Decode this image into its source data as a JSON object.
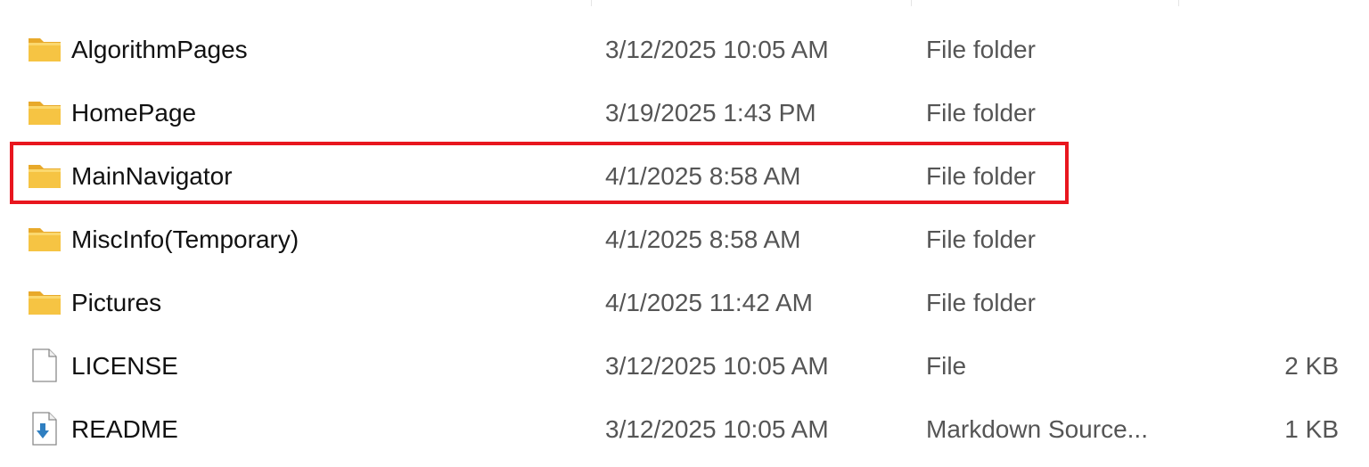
{
  "colors": {
    "highlight": "#e8161e",
    "folder": "#f6c443",
    "secondary_text": "#555555"
  },
  "files": [
    {
      "name": "AlgorithmPages",
      "date": "3/12/2025 10:05 AM",
      "type": "File folder",
      "size": "",
      "icon": "folder-icon"
    },
    {
      "name": "HomePage",
      "date": "3/19/2025 1:43 PM",
      "type": "File folder",
      "size": "",
      "icon": "folder-icon"
    },
    {
      "name": "MainNavigator",
      "date": "4/1/2025 8:58 AM",
      "type": "File folder",
      "size": "",
      "icon": "folder-icon"
    },
    {
      "name": "MiscInfo(Temporary)",
      "date": "4/1/2025 8:58 AM",
      "type": "File folder",
      "size": "",
      "icon": "folder-icon"
    },
    {
      "name": "Pictures",
      "date": "4/1/2025 11:42 AM",
      "type": "File folder",
      "size": "",
      "icon": "folder-icon"
    },
    {
      "name": "LICENSE",
      "date": "3/12/2025 10:05 AM",
      "type": "File",
      "size": "2 KB",
      "icon": "file-icon"
    },
    {
      "name": "README",
      "date": "3/12/2025 10:05 AM",
      "type": "Markdown Source...",
      "size": "1 KB",
      "icon": "markdown-file-icon"
    }
  ]
}
